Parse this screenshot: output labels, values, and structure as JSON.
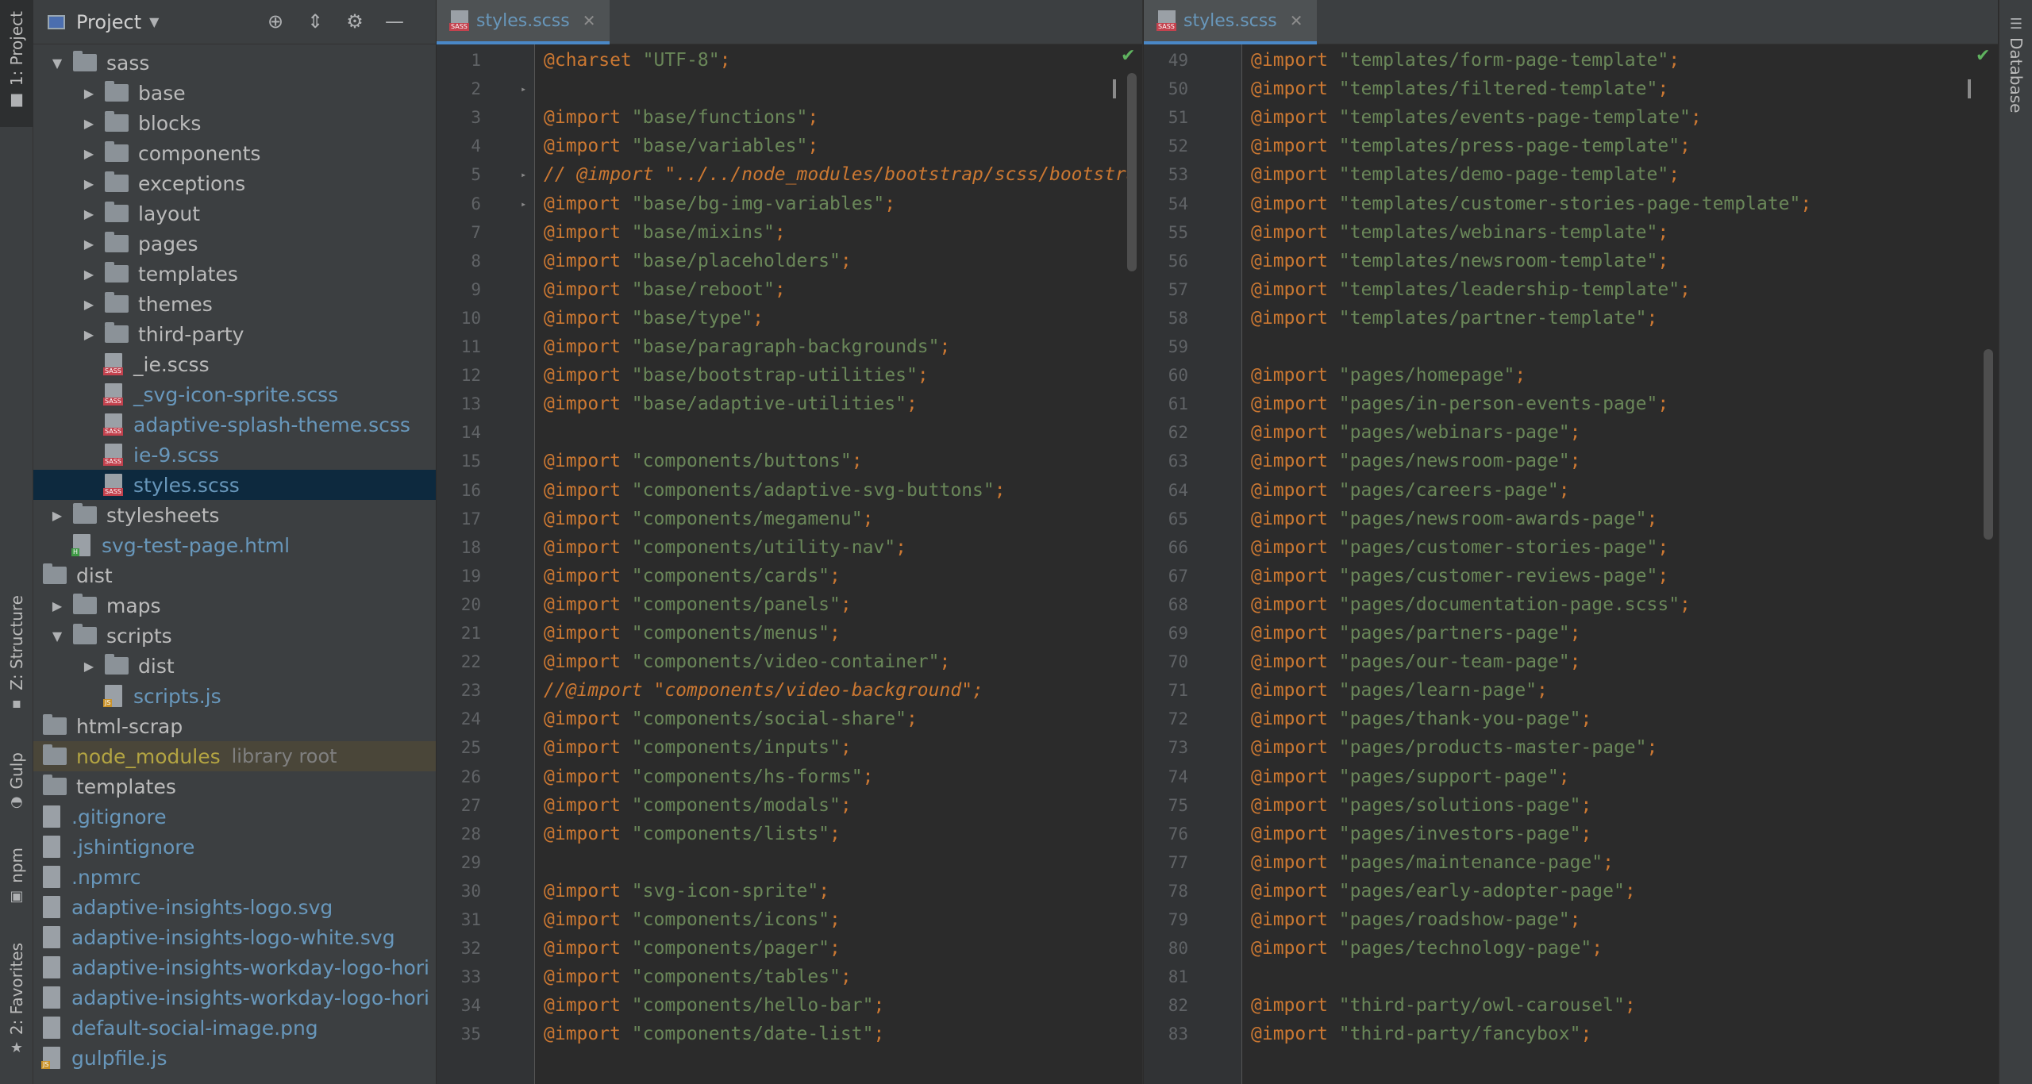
{
  "left_stripe": {
    "tabs": [
      {
        "label": "1: Project",
        "icon": "folder-icon",
        "active": true
      },
      {
        "label": "Z: Structure",
        "icon": "structure-icon"
      },
      {
        "label": "Gulp",
        "icon": "gulp-icon"
      },
      {
        "label": "npm",
        "icon": "npm-icon"
      },
      {
        "label": "2: Favorites",
        "icon": "star-icon"
      }
    ]
  },
  "right_stripe": {
    "tabs": [
      {
        "label": "Database",
        "icon": "database-icon"
      }
    ]
  },
  "project_panel": {
    "title": "Project",
    "tree": [
      {
        "name": "sass",
        "type": "folder",
        "depth": 0,
        "expanded": true
      },
      {
        "name": "base",
        "type": "folder",
        "depth": 1
      },
      {
        "name": "blocks",
        "type": "folder",
        "depth": 1
      },
      {
        "name": "components",
        "type": "folder",
        "depth": 1
      },
      {
        "name": "exceptions",
        "type": "folder",
        "depth": 1
      },
      {
        "name": "layout",
        "type": "folder",
        "depth": 1
      },
      {
        "name": "pages",
        "type": "folder",
        "depth": 1
      },
      {
        "name": "templates",
        "type": "folder",
        "depth": 1
      },
      {
        "name": "themes",
        "type": "folder",
        "depth": 1
      },
      {
        "name": "third-party",
        "type": "folder",
        "depth": 1
      },
      {
        "name": "_ie.scss",
        "type": "sass",
        "depth": 1
      },
      {
        "name": "_svg-icon-sprite.scss",
        "type": "sass",
        "depth": 1,
        "color": "blue"
      },
      {
        "name": "adaptive-splash-theme.scss",
        "type": "sass",
        "depth": 1,
        "color": "blue"
      },
      {
        "name": "ie-9.scss",
        "type": "sass",
        "depth": 1,
        "color": "blue"
      },
      {
        "name": "styles.scss",
        "type": "sass",
        "depth": 1,
        "color": "blue",
        "selected": true
      },
      {
        "name": "stylesheets",
        "type": "folder",
        "depth": 0
      },
      {
        "name": "svg-test-page.html",
        "type": "html",
        "depth": 0,
        "color": "blue"
      },
      {
        "name": "dist",
        "type": "folder",
        "depth": -1
      },
      {
        "name": "maps",
        "type": "folder",
        "depth": 0
      },
      {
        "name": "scripts",
        "type": "folder",
        "depth": 0,
        "expanded": true
      },
      {
        "name": "dist",
        "type": "folder",
        "depth": 1
      },
      {
        "name": "scripts.js",
        "type": "js",
        "depth": 1,
        "color": "blue"
      },
      {
        "name": "html-scrap",
        "type": "folder",
        "depth": -1
      },
      {
        "name": "node_modules",
        "type": "folder",
        "depth": -1,
        "color": "yellow",
        "library": "library root"
      },
      {
        "name": "templates",
        "type": "folder",
        "depth": -1
      },
      {
        "name": ".gitignore",
        "type": "txt",
        "depth": -1,
        "color": "blue"
      },
      {
        "name": ".jshintignore",
        "type": "txt",
        "depth": -1,
        "color": "blue"
      },
      {
        "name": ".npmrc",
        "type": "txt",
        "depth": -1,
        "color": "blue"
      },
      {
        "name": "adaptive-insights-logo.svg",
        "type": "img",
        "depth": -1,
        "color": "blue"
      },
      {
        "name": "adaptive-insights-logo-white.svg",
        "type": "img",
        "depth": -1,
        "color": "blue"
      },
      {
        "name": "adaptive-insights-workday-logo-hori",
        "type": "img",
        "depth": -1,
        "color": "blue"
      },
      {
        "name": "adaptive-insights-workday-logo-hori",
        "type": "img",
        "depth": -1,
        "color": "blue"
      },
      {
        "name": "default-social-image.png",
        "type": "img",
        "depth": -1,
        "color": "blue"
      },
      {
        "name": "gulpfile.js",
        "type": "js",
        "depth": -1,
        "color": "blue"
      }
    ]
  },
  "editor_left": {
    "tab": "styles.scss",
    "lines": [
      {
        "n": "1",
        "kw": "@charset",
        "str": " \"UTF-8\"",
        "tail": ";"
      },
      {
        "n": "2"
      },
      {
        "n": "3",
        "kw": "@import",
        "str": " \"base/functions\"",
        "tail": ";"
      },
      {
        "n": "4",
        "kw": "@import",
        "str": " \"base/variables\"",
        "tail": ";"
      },
      {
        "n": "5",
        "cmt": "// @import \"../../node_modules/bootstrap/scss/bootstra"
      },
      {
        "n": "6",
        "kw": "@import",
        "str": " \"base/bg-img-variables\"",
        "tail": ";"
      },
      {
        "n": "7",
        "kw": "@import",
        "str": " \"base/mixins\"",
        "tail": ";"
      },
      {
        "n": "8",
        "kw": "@import",
        "str": " \"base/placeholders\"",
        "tail": ";"
      },
      {
        "n": "9",
        "kw": "@import",
        "str": " \"base/reboot\"",
        "tail": ";"
      },
      {
        "n": "10",
        "kw": "@import",
        "str": " \"base/type\"",
        "tail": ";"
      },
      {
        "n": "11",
        "kw": "@import",
        "str": " \"base/paragraph-backgrounds\"",
        "tail": ";"
      },
      {
        "n": "12",
        "kw": "@import",
        "str": " \"base/bootstrap-utilities\"",
        "tail": ";"
      },
      {
        "n": "13",
        "kw": "@import",
        "str": " \"base/adaptive-utilities\"",
        "tail": ";"
      },
      {
        "n": "14"
      },
      {
        "n": "15",
        "kw": "@import",
        "str": " \"components/buttons\"",
        "tail": ";"
      },
      {
        "n": "16",
        "kw": "@import",
        "str": " \"components/adaptive-svg-buttons\"",
        "tail": ";"
      },
      {
        "n": "17",
        "kw": "@import",
        "str": " \"components/megamenu\"",
        "tail": ";"
      },
      {
        "n": "18",
        "kw": "@import",
        "str": " \"components/utility-nav\"",
        "tail": ";"
      },
      {
        "n": "19",
        "kw": "@import",
        "str": " \"components/cards\"",
        "tail": ";"
      },
      {
        "n": "20",
        "kw": "@import",
        "str": " \"components/panels\"",
        "tail": ";"
      },
      {
        "n": "21",
        "kw": "@import",
        "str": " \"components/menus\"",
        "tail": ";"
      },
      {
        "n": "22",
        "kw": "@import",
        "str": " \"components/video-container\"",
        "tail": ";"
      },
      {
        "n": "23",
        "cmt": "//@import \"components/video-background\";"
      },
      {
        "n": "24",
        "kw": "@import",
        "str": " \"components/social-share\"",
        "tail": ";"
      },
      {
        "n": "25",
        "kw": "@import",
        "str": " \"components/inputs\"",
        "tail": ";"
      },
      {
        "n": "26",
        "kw": "@import",
        "str": " \"components/hs-forms\"",
        "tail": ";"
      },
      {
        "n": "27",
        "kw": "@import",
        "str": " \"components/modals\"",
        "tail": ";"
      },
      {
        "n": "28",
        "kw": "@import",
        "str": " \"components/lists\"",
        "tail": ";"
      },
      {
        "n": "29"
      },
      {
        "n": "30",
        "kw": "@import",
        "str": " \"svg-icon-sprite\"",
        "tail": ";"
      },
      {
        "n": "31",
        "kw": "@import",
        "str": " \"components/icons\"",
        "tail": ";"
      },
      {
        "n": "32",
        "kw": "@import",
        "str": " \"components/pager\"",
        "tail": ";"
      },
      {
        "n": "33",
        "kw": "@import",
        "str": " \"components/tables\"",
        "tail": ";"
      },
      {
        "n": "34",
        "kw": "@import",
        "str": " \"components/hello-bar\"",
        "tail": ";"
      },
      {
        "n": "35",
        "kw": "@import",
        "str": " \"components/date-list\"",
        "tail": ";"
      }
    ]
  },
  "editor_right": {
    "tab": "styles.scss",
    "lines": [
      {
        "n": "49",
        "kw": "@import",
        "str": " \"templates/form-page-template\"",
        "tail": ";"
      },
      {
        "n": "50",
        "kw": "@import",
        "str": " \"templates/filtered-template\"",
        "tail": ";"
      },
      {
        "n": "51",
        "kw": "@import",
        "str": " \"templates/events-page-template\"",
        "tail": ";"
      },
      {
        "n": "52",
        "kw": "@import",
        "str": " \"templates/press-page-template\"",
        "tail": ";"
      },
      {
        "n": "53",
        "kw": "@import",
        "str": " \"templates/demo-page-template\"",
        "tail": ";"
      },
      {
        "n": "54",
        "kw": "@import",
        "str": " \"templates/customer-stories-page-template\"",
        "tail": ";"
      },
      {
        "n": "55",
        "kw": "@import",
        "str": " \"templates/webinars-template\"",
        "tail": ";"
      },
      {
        "n": "56",
        "kw": "@import",
        "str": " \"templates/newsroom-template\"",
        "tail": ";"
      },
      {
        "n": "57",
        "kw": "@import",
        "str": " \"templates/leadership-template\"",
        "tail": ";"
      },
      {
        "n": "58",
        "kw": "@import",
        "str": " \"templates/partner-template\"",
        "tail": ";"
      },
      {
        "n": "59"
      },
      {
        "n": "60",
        "kw": "@import",
        "str": " \"pages/homepage\"",
        "tail": ";"
      },
      {
        "n": "61",
        "kw": "@import",
        "str": " \"pages/in-person-events-page\"",
        "tail": ";"
      },
      {
        "n": "62",
        "kw": "@import",
        "str": " \"pages/webinars-page\"",
        "tail": ";"
      },
      {
        "n": "63",
        "kw": "@import",
        "str": " \"pages/newsroom-page\"",
        "tail": ";"
      },
      {
        "n": "64",
        "kw": "@import",
        "str": " \"pages/careers-page\"",
        "tail": ";"
      },
      {
        "n": "65",
        "kw": "@import",
        "str": " \"pages/newsroom-awards-page\"",
        "tail": ";"
      },
      {
        "n": "66",
        "kw": "@import",
        "str": " \"pages/customer-stories-page\"",
        "tail": ";"
      },
      {
        "n": "67",
        "kw": "@import",
        "str": " \"pages/customer-reviews-page\"",
        "tail": ";"
      },
      {
        "n": "68",
        "kw": "@import",
        "str": " \"pages/documentation-page.scss\"",
        "tail": ";"
      },
      {
        "n": "69",
        "kw": "@import",
        "str": " \"pages/partners-page\"",
        "tail": ";"
      },
      {
        "n": "70",
        "kw": "@import",
        "str": " \"pages/our-team-page\"",
        "tail": ";"
      },
      {
        "n": "71",
        "kw": "@import",
        "str": " \"pages/learn-page\"",
        "tail": ";"
      },
      {
        "n": "72",
        "kw": "@import",
        "str": " \"pages/thank-you-page\"",
        "tail": ";"
      },
      {
        "n": "73",
        "kw": "@import",
        "str": " \"pages/products-master-page\"",
        "tail": ";"
      },
      {
        "n": "74",
        "kw": "@import",
        "str": " \"pages/support-page\"",
        "tail": ";"
      },
      {
        "n": "75",
        "kw": "@import",
        "str": " \"pages/solutions-page\"",
        "tail": ";"
      },
      {
        "n": "76",
        "kw": "@import",
        "str": " \"pages/investors-page\"",
        "tail": ";"
      },
      {
        "n": "77",
        "kw": "@import",
        "str": " \"pages/maintenance-page\"",
        "tail": ";"
      },
      {
        "n": "78",
        "kw": "@import",
        "str": " \"pages/early-adopter-page\"",
        "tail": ";"
      },
      {
        "n": "79",
        "kw": "@import",
        "str": " \"pages/roadshow-page\"",
        "tail": ";"
      },
      {
        "n": "80",
        "kw": "@import",
        "str": " \"pages/technology-page\"",
        "tail": ";"
      },
      {
        "n": "81"
      },
      {
        "n": "82",
        "kw": "@import",
        "str": " \"third-party/owl-carousel\"",
        "tail": ";"
      },
      {
        "n": "83",
        "kw": "@import",
        "str": " \"third-party/fancybox\"",
        "tail": ";"
      }
    ]
  },
  "colors": {
    "keyword": "#cc7832",
    "string": "#6a8759",
    "blue_file": "#6897bb",
    "selection": "#0d293e"
  }
}
